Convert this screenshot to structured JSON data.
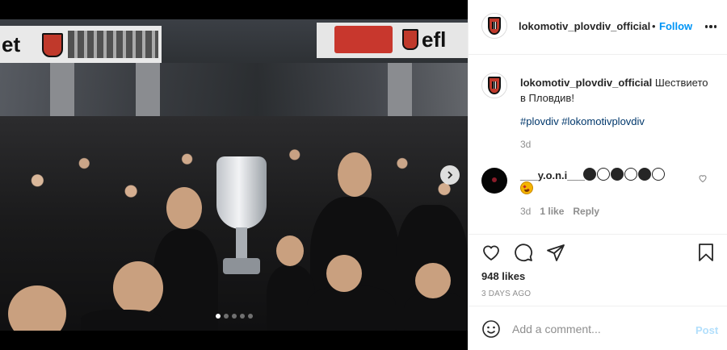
{
  "post": {
    "username": "lokomotiv_plovdiv_official",
    "follow_label": "Follow",
    "bullet": "•",
    "caption": "Шествието в Пловдив!",
    "hashtags": "#plovdiv #lokomotivplovdiv",
    "caption_time": "3d"
  },
  "media": {
    "sign_left_text": "et",
    "sign_right_text": "efl",
    "carousel_count": 5,
    "carousel_active_index": 0
  },
  "comment": {
    "username": "___y.o.n.i___",
    "circle_pattern": [
      true,
      false,
      true,
      false,
      true,
      false
    ],
    "emoji": "star-struck-emoji",
    "time": "3d",
    "likes": "1 like",
    "reply_label": "Reply"
  },
  "actions": {
    "likes": "948 likes",
    "date": "3 DAYS AGO"
  },
  "add_comment": {
    "placeholder": "Add a comment...",
    "post_label": "Post"
  },
  "colors": {
    "link_blue": "#0095f6",
    "hashtag_blue": "#00376b",
    "post_disabled": "#b2dffc",
    "muted": "#8e8e8e",
    "club_red": "#c0392b"
  }
}
